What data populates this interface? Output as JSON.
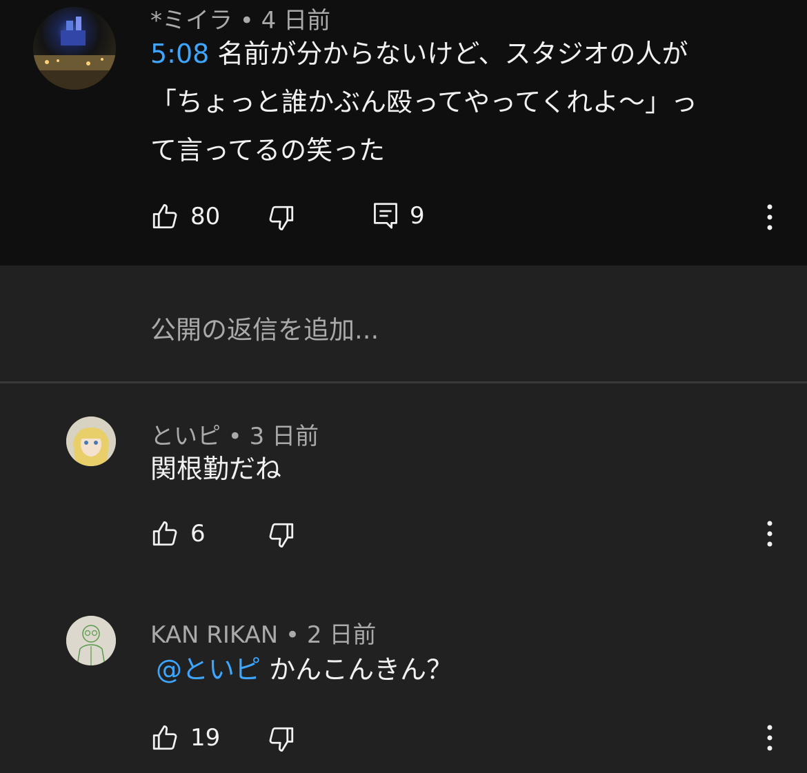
{
  "top_comment": {
    "author": "*ミイラ",
    "age": "4 日前",
    "timestamp_link": "5:08",
    "text_line1": " 名前が分からないけど、スタジオの人が",
    "text_line2": "「ちょっと誰かぶん殴ってやってくれよ〜」っ",
    "text_line3": "て言ってるの笑った",
    "likes": "80",
    "replies": "9"
  },
  "reply_box": {
    "placeholder": "公開の返信を追加..."
  },
  "replies": [
    {
      "author": "といピ",
      "age": "3 日前",
      "text": "関根勤だね",
      "likes": "6"
    },
    {
      "author": "KAN RIKAN",
      "age": "2 日前",
      "mention": "@といピ",
      "text": " かんこんきん？",
      "likes": "19"
    }
  ],
  "separator": " • ",
  "icons": {
    "like": "thumbs-up-icon",
    "dislike": "thumbs-down-icon",
    "reply": "comment-icon",
    "more": "more-vertical-icon"
  },
  "colors": {
    "background": "#0f0f0f",
    "panel": "#212121",
    "link": "#3ea6ff",
    "secondary_text": "#aaaaaa"
  }
}
